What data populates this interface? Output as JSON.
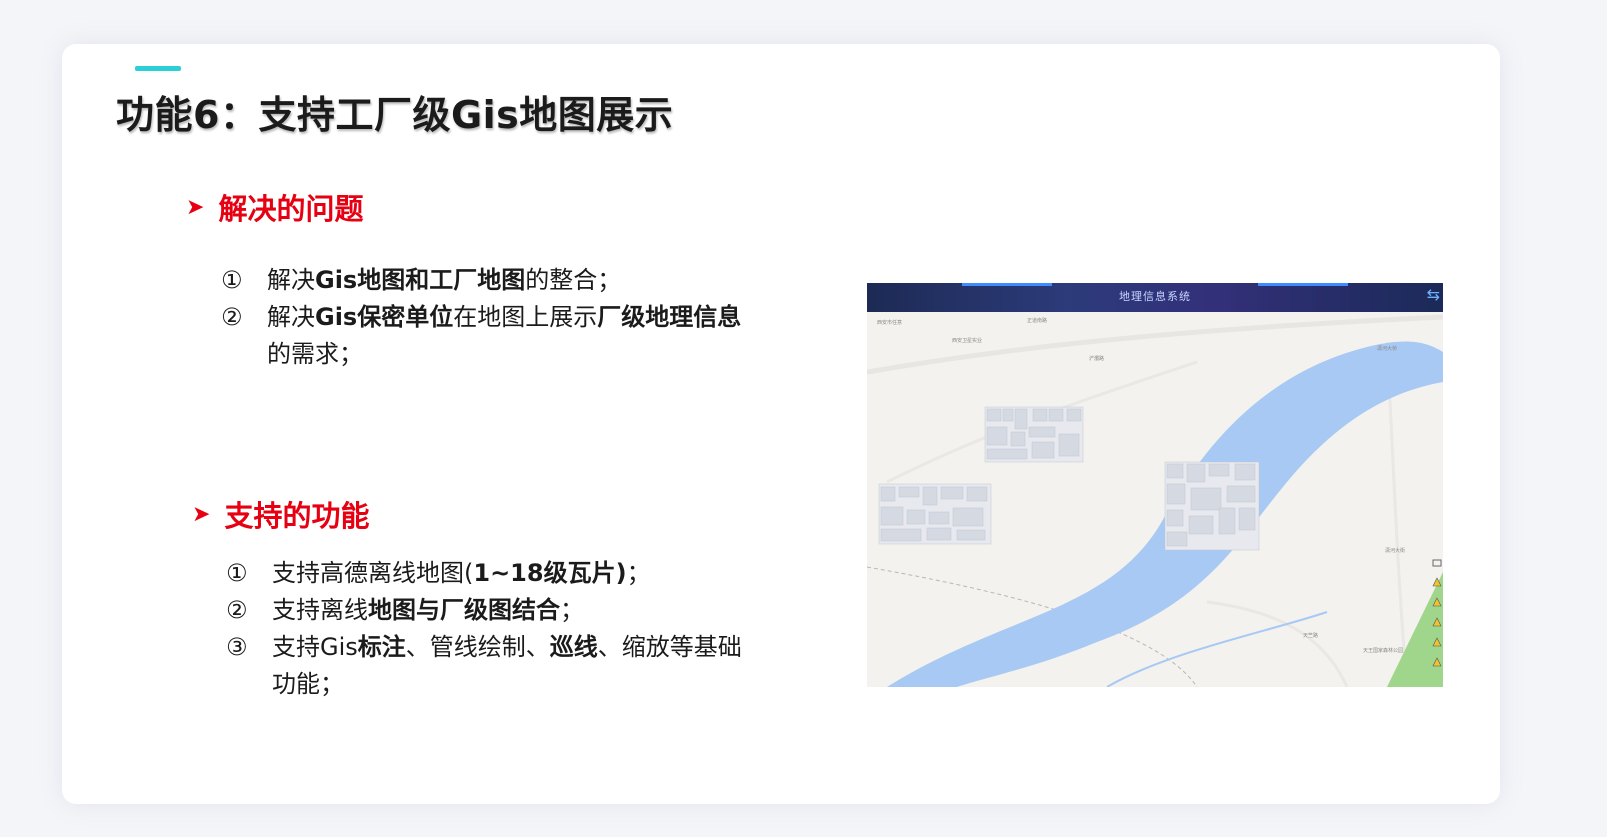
{
  "title": "功能6：支持工厂级Gis地图展示",
  "section1": {
    "heading": "解决的问题",
    "items": [
      {
        "num": "①",
        "parts": [
          {
            "text": "解决",
            "bold": false
          },
          {
            "text": "Gis地图和工厂地图",
            "bold": true
          },
          {
            "text": "的整合；",
            "bold": false
          }
        ]
      },
      {
        "num": "②",
        "parts": [
          {
            "text": "解决",
            "bold": false
          },
          {
            "text": "Gis保密单位",
            "bold": true
          },
          {
            "text": "在地图上展示",
            "bold": false
          },
          {
            "text": "厂级地理信息",
            "bold": true
          },
          {
            "text": "的需求；",
            "bold": false
          }
        ]
      }
    ]
  },
  "section2": {
    "heading": "支持的功能",
    "items": [
      {
        "num": "①",
        "parts": [
          {
            "text": "支持高德离线地图(",
            "bold": false
          },
          {
            "text": "1~18级瓦片)",
            "bold": true
          },
          {
            "text": "；",
            "bold": false
          }
        ]
      },
      {
        "num": "②",
        "parts": [
          {
            "text": "支持离线",
            "bold": false
          },
          {
            "text": "地图与厂级图结合",
            "bold": true
          },
          {
            "text": "；",
            "bold": false
          }
        ]
      },
      {
        "num": "③",
        "parts": [
          {
            "text": "支持Gis",
            "bold": false
          },
          {
            "text": "标注",
            "bold": true
          },
          {
            "text": "、管线绘制、",
            "bold": false
          },
          {
            "text": "巡线",
            "bold": true
          },
          {
            "text": "、缩放等基础功能；",
            "bold": false
          }
        ]
      }
    ]
  },
  "gis_screenshot": {
    "header_title": "地理信息系统",
    "exit_icon": "exit-icon",
    "colors": {
      "river": "#a8c9f3",
      "land": "#f3f2ee",
      "header": "#2c3b7a",
      "park": "#9fd68b"
    },
    "labels": [
      "西安市任意",
      "西安卫星实业",
      "正道南路",
      "潇河大桥",
      "浐灞路",
      "潇河大街",
      "天竺路",
      "天王国家森林公园"
    ]
  }
}
